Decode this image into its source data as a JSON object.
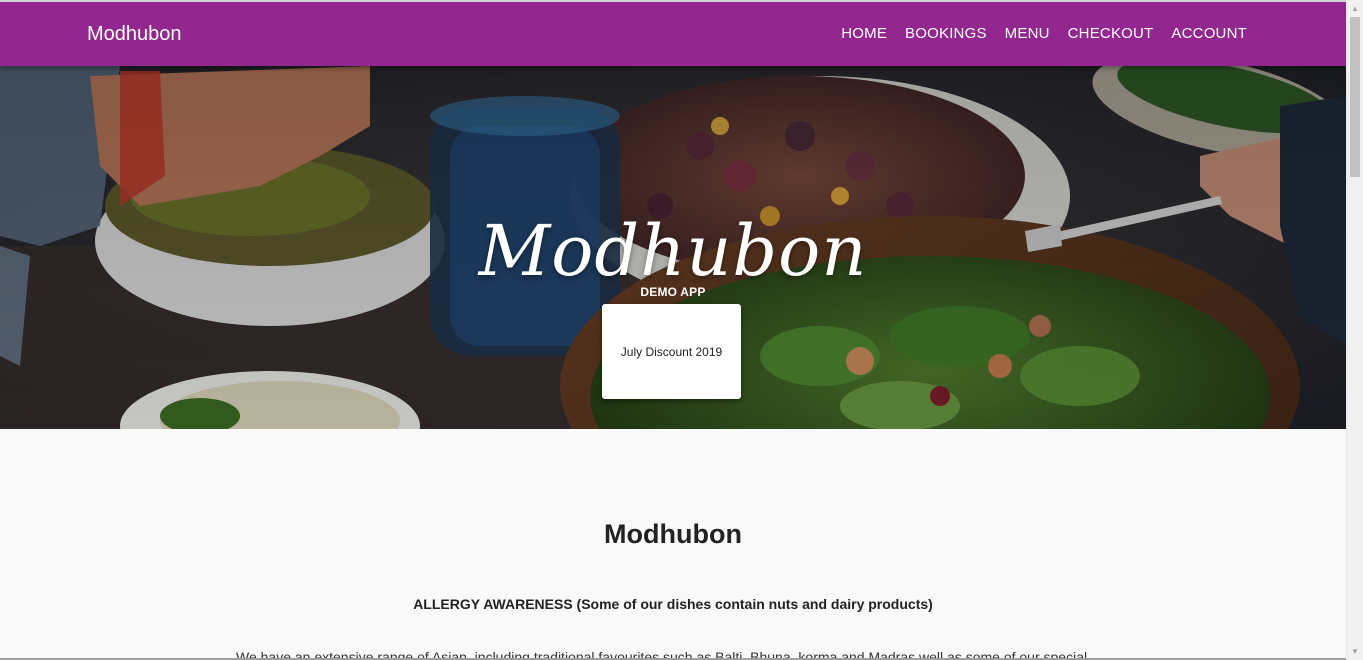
{
  "navbar": {
    "brand": "Modhubon",
    "links": [
      "HOME",
      "BOOKINGS",
      "MENU",
      "CHECKOUT",
      "ACCOUNT"
    ],
    "background_color": "#92278f"
  },
  "hero": {
    "title": "Modhubon",
    "subtitle": "DEMO APP",
    "promo_card": "July Discount 2019"
  },
  "content": {
    "title": "Modhubon",
    "allergy_notice": "ALLERGY AWARENESS (Some of our dishes contain nuts and dairy products)",
    "intro": "We have an extensive range of Asian, including traditional favourites such as Balti, Bhuna, korma and Madras well as some of our special"
  },
  "scrollbar": {
    "up_icon": "triangle-up",
    "down_icon": "triangle-down"
  }
}
